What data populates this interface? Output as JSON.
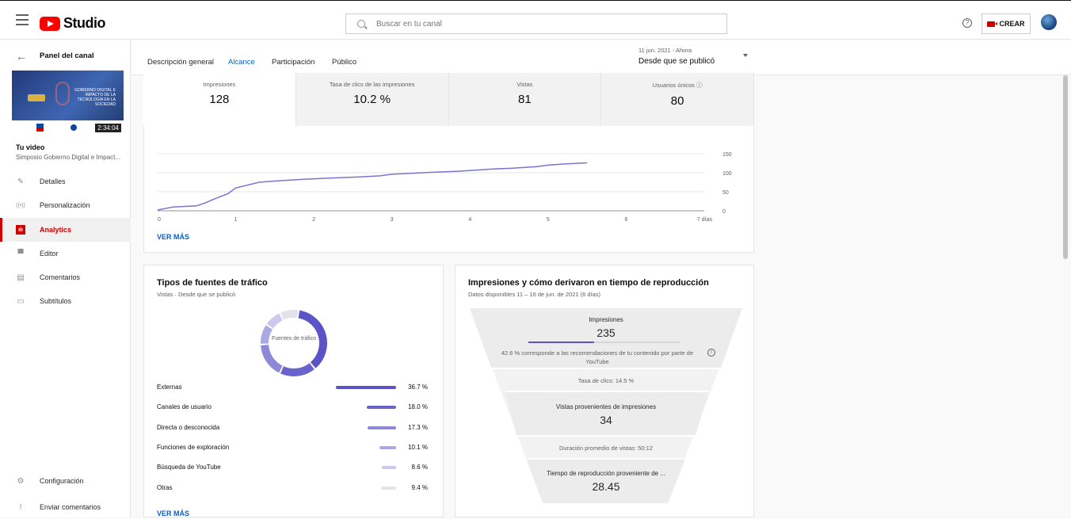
{
  "header": {
    "logo_text": "Studio",
    "search_placeholder": "Buscar en tu canal",
    "help_glyph": "?",
    "create_label": "CREAR"
  },
  "sidebar": {
    "panel_title": "Panel del canal",
    "thumb_text": "GOBIERNO DIGITAL E IMPACTO DE LA TECNOLOGÍA EN LA SOCIEDAD",
    "duration": "2:34:04",
    "video_heading": "Tu video",
    "video_title": "Simposio Gobierno Digital e Impact...",
    "items": [
      {
        "label": "Detalles",
        "icon": "pencil-icon",
        "glyph": "✎"
      },
      {
        "label": "Personalización",
        "icon": "broadcast-icon",
        "glyph": "((•))"
      },
      {
        "label": "Analytics",
        "icon": "analytics-icon",
        "glyph": "ılı"
      },
      {
        "label": "Editor",
        "icon": "clapper-icon",
        "glyph": "▀"
      },
      {
        "label": "Comentarios",
        "icon": "comment-icon",
        "glyph": "▤"
      },
      {
        "label": "Subtítulos",
        "icon": "subtitles-icon",
        "glyph": "▭"
      }
    ],
    "settings_label": "Configuración",
    "feedback_label": "Enviar comentarios"
  },
  "tabs": [
    {
      "label": "Descripción general",
      "active": false
    },
    {
      "label": "Alcance",
      "active": true
    },
    {
      "label": "Participación",
      "active": false
    },
    {
      "label": "Público",
      "active": false
    }
  ],
  "date_range": {
    "dates": "11 jun. 2021 - Ahora",
    "label": "Desde que se publicó"
  },
  "metrics": [
    {
      "label": "Impresiones",
      "value": "128"
    },
    {
      "label": "Tasa de clics de las impresiones",
      "value": "10.2 %"
    },
    {
      "label": "Vistas",
      "value": "81"
    },
    {
      "label": "Usuarios únicos",
      "value": "80",
      "info_icon": "info-icon"
    }
  ],
  "chart_data": {
    "type": "line",
    "x_tick_labels": [
      "0",
      "1",
      "2",
      "3",
      "4",
      "5",
      "6",
      "7 días"
    ],
    "y_tick_labels": [
      "150",
      "100",
      "50",
      "0"
    ],
    "ylim": [
      0,
      150
    ],
    "xlim": [
      0,
      7
    ],
    "x": [
      0,
      0.2,
      0.5,
      0.6,
      0.75,
      0.9,
      1.0,
      1.3,
      1.5,
      1.8,
      2.2,
      2.6,
      2.85,
      3.0,
      3.5,
      3.85,
      4.3,
      4.55,
      4.85,
      5.0,
      5.2,
      5.5
    ],
    "values": [
      2,
      10,
      13,
      20,
      33,
      45,
      60,
      75,
      78,
      82,
      86,
      89,
      92,
      96,
      101,
      104,
      110,
      112,
      116,
      120,
      123,
      126
    ],
    "color": "#7b74d0",
    "grid": true,
    "more_label": "VER MÁS"
  },
  "traffic": {
    "title": "Tipos de fuentes de tráfico",
    "subtitle": "Vistas · Desde que se publicó",
    "donut_label": "Fuentes de tráfico",
    "rows": [
      {
        "label": "Externas",
        "pct": 36.7,
        "pct_text": "36.7 %",
        "color": "#5c54c6"
      },
      {
        "label": "Canales de usuario",
        "pct": 18.0,
        "pct_text": "18.0 %",
        "color": "#6a63cc"
      },
      {
        "label": "Directa o desconocida",
        "pct": 17.3,
        "pct_text": "17.3 %",
        "color": "#8e88d8"
      },
      {
        "label": "Funciones de exploración",
        "pct": 10.1,
        "pct_text": "10.1 %",
        "color": "#aca8e4"
      },
      {
        "label": "Búsqueda de YouTube",
        "pct": 8.6,
        "pct_text": "8.6 %",
        "color": "#cbc9ee"
      },
      {
        "label": "Otras",
        "pct": 9.4,
        "pct_text": "9.4 %",
        "color": "#e2e2ea"
      }
    ],
    "more_label": "VER MÁS"
  },
  "funnel": {
    "title": "Impresiones y cómo derivaron en tiempo de reproducción",
    "subtitle": "Datos disponibles 11 – 16 de jun. de 2021 (6 días)",
    "impressions_label": "Impresiones",
    "impressions_value": "235",
    "impressions_progress": 0.43,
    "reco_text": "42.6 % corresponde a las recomendaciones de tu contenido por parte de YouTube",
    "ctr_text": "Tasa de clics: 14.5 %",
    "views_label": "Vistas provenientes de impresiones",
    "views_value": "34",
    "avg_duration_text": "Duración promedio de vistas: 50:12",
    "watch_time_label": "Tiempo de reproducción proveniente de ...",
    "watch_time_value": "28.45"
  }
}
